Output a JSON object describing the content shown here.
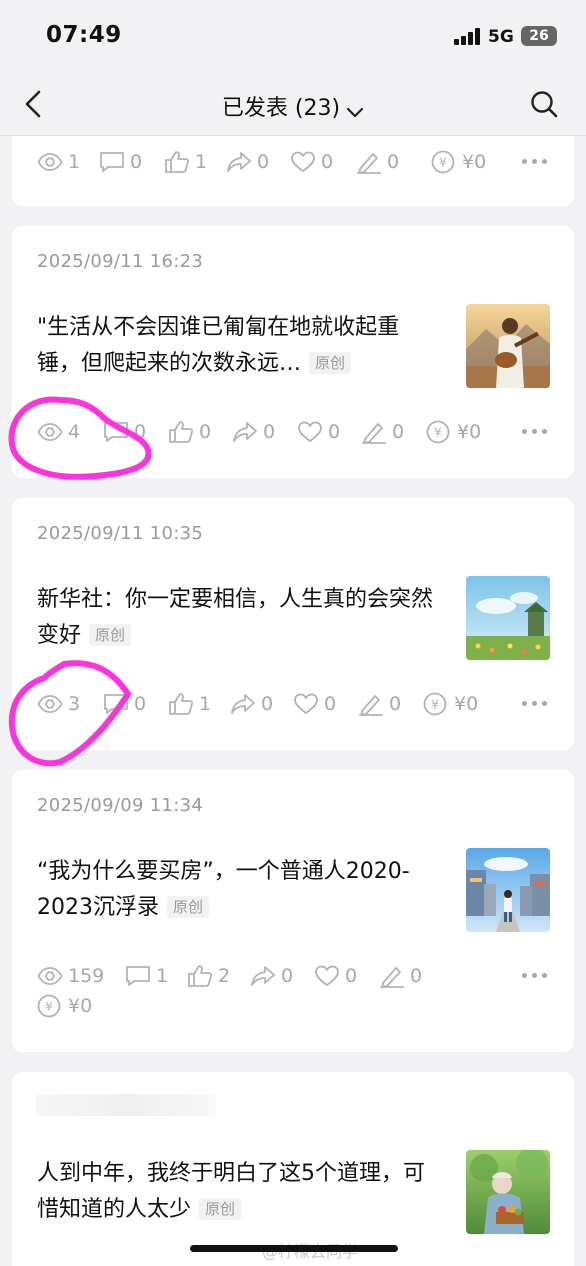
{
  "status_bar": {
    "time": "07:49",
    "network": "5G",
    "battery": "26"
  },
  "nav": {
    "title": "已发表 (23)"
  },
  "colors": {
    "annotation": "#ff33dd",
    "muted": "#a8a8a8",
    "card_bg": "#ffffff",
    "page_bg": "#f2f2f4"
  },
  "icons": [
    "eye-icon",
    "comment-icon",
    "thumbs-up-icon",
    "share-icon",
    "heart-icon",
    "pencil-icon",
    "yen-coin-icon",
    "more-icon"
  ],
  "cards": [
    {
      "stats": {
        "views": "1",
        "comments": "0",
        "likes": "1",
        "shares": "0",
        "favorites": "0",
        "edits": "0",
        "earnings": "¥0"
      }
    },
    {
      "date": "2025/09/11 16:23",
      "title": "\"生活从不会因谁已匍匐在地就收起重锤，但爬起来的次数永远…",
      "tag": "原创",
      "stats": {
        "views": "4",
        "comments": "0",
        "likes": "0",
        "shares": "0",
        "favorites": "0",
        "edits": "0",
        "earnings": "¥0"
      }
    },
    {
      "date": "2025/09/11 10:35",
      "title": "新华社：你一定要相信，人生真的会突然变好",
      "tag": "原创",
      "stats": {
        "views": "3",
        "comments": "0",
        "likes": "1",
        "shares": "0",
        "favorites": "0",
        "edits": "0",
        "earnings": "¥0"
      }
    },
    {
      "date": "2025/09/09 11:34",
      "title": "“我为什么要买房”，一个普通人2020-2023沉浮录",
      "tag": "原创",
      "stats": {
        "views": "159",
        "comments": "1",
        "likes": "2",
        "shares": "0",
        "favorites": "0",
        "edits": "0",
        "earnings": "¥0"
      }
    },
    {
      "title": "人到中年，我终于明白了这5个道理，可惜知道的人太少",
      "tag": "原创"
    }
  ],
  "watermark": "@柠檬去同学"
}
